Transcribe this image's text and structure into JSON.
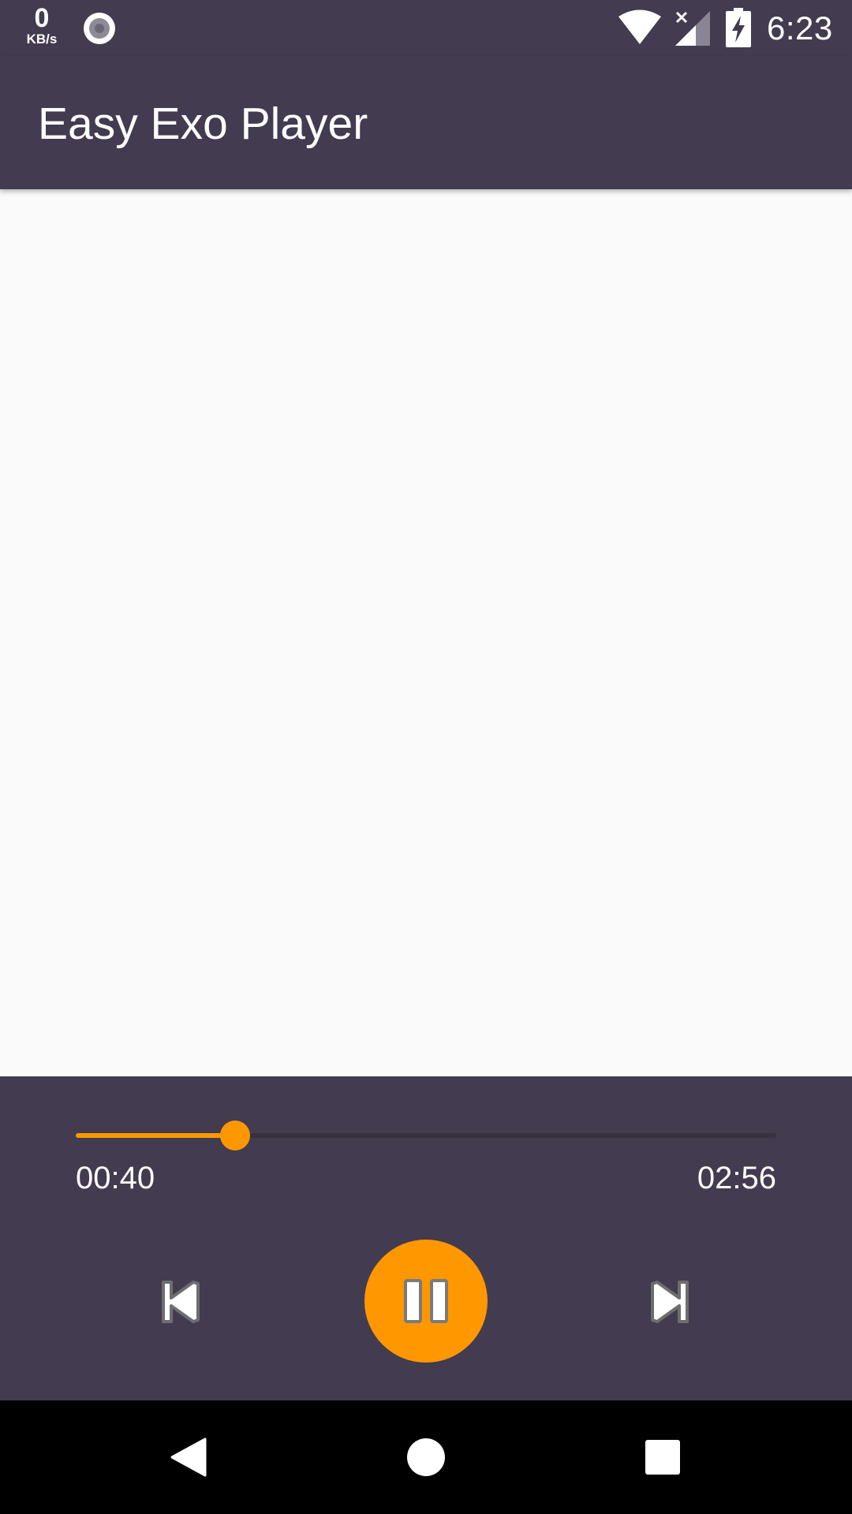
{
  "status_bar": {
    "net_speed_value": "0",
    "net_speed_unit": "KB/s",
    "time": "6:23",
    "icons": [
      "record-icon",
      "wifi-icon",
      "signal-no-sim-icon",
      "battery-charging-icon"
    ]
  },
  "app_bar": {
    "title": "Easy Exo Player"
  },
  "player": {
    "current_time": "00:40",
    "total_time": "02:56",
    "progress_fraction": 0.227,
    "controls": {
      "previous": "skip-previous-icon",
      "play_pause": "pause-icon",
      "next": "skip-next-icon"
    }
  },
  "nav_bar": {
    "buttons": [
      "back-icon",
      "home-icon",
      "recents-icon"
    ]
  },
  "colors": {
    "primary": "#433b50",
    "accent": "#ff9800",
    "background": "#fafafa",
    "nav": "#000000"
  }
}
